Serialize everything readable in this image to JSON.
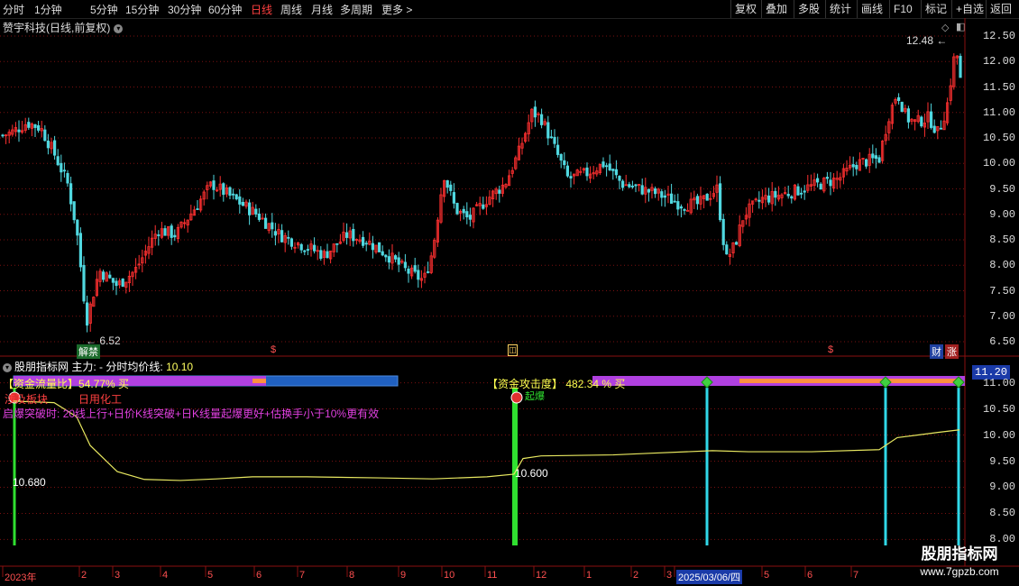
{
  "toolbar": {
    "periods": [
      "分时",
      "1分钟",
      "5分钟",
      "15分钟",
      "30分钟",
      "60分钟",
      "日线",
      "周线",
      "月线",
      "多周期",
      "更多 >"
    ],
    "active_period": "日线",
    "right_buttons": [
      "复权",
      "叠加",
      "多股",
      "统计",
      "画线",
      "F10",
      "标记",
      "+自选",
      "返回"
    ]
  },
  "chart_title": "赞宇科技(日线,前复权)",
  "price_axis": [
    "12.50",
    "12.00",
    "11.50",
    "11.00",
    "10.50",
    "10.00",
    "9.50",
    "9.00",
    "8.50",
    "8.00",
    "7.50",
    "7.00",
    "6.50"
  ],
  "annotations": {
    "high": "12.48",
    "low": "6.52",
    "tag_jiejin": "解禁",
    "tag_cai": "财",
    "tag_zhang": "涨"
  },
  "indicator": {
    "name": "股朋指标网",
    "main_label": "主力: -",
    "avg_label": "分时均价线:",
    "avg_value": "10.10",
    "ratio_label": "【资金流量比】",
    "ratio_value": "54.77% 买",
    "sector_label": "涉及板块",
    "sector_value": "日用化工",
    "desc_label": "启爆突破时:",
    "desc_text": "20线上行+日价K线突破+日K线量起爆更好+估换手小于10%更有效",
    "strength_label": "【资金攻击度】",
    "strength_value": "482.34 % 买",
    "signal_text": "起爆",
    "level_left": "10.680",
    "level_right": "10.600",
    "current_price": "11.20",
    "axis": [
      "11.00",
      "10.50",
      "10.00",
      "9.50",
      "9.00",
      "8.50",
      "8.00"
    ]
  },
  "date_axis": [
    "2023年",
    "2",
    "3",
    "4",
    "5",
    "6",
    "7",
    "8",
    "9",
    "10",
    "11",
    "12",
    "1",
    "2",
    "3",
    "2025/03/06/四",
    "5",
    "6",
    "7"
  ],
  "watermark": {
    "line1": "股朋指标网",
    "line2": "www.7gpzb.com"
  },
  "colors": {
    "up": "#ff3030",
    "down": "#50d8e0",
    "grid": "#7a1010",
    "avg_line": "#e8e860",
    "signal_green": "#30e030",
    "signal_cyan": "#30d8e8"
  }
}
